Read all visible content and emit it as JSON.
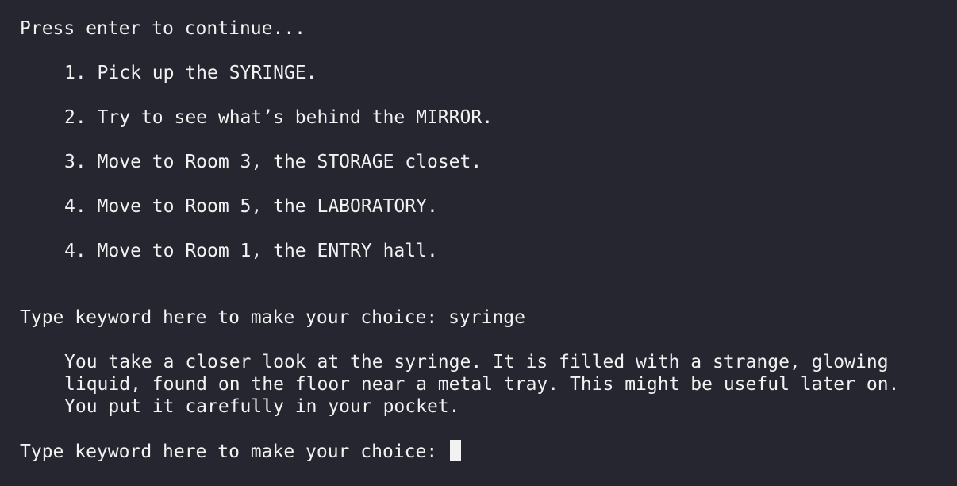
{
  "terminal": {
    "continue_prompt": "Press enter to continue...",
    "options": [
      "1. Pick up the SYRINGE.",
      "2. Try to see what’s behind the MIRROR.",
      "3. Move to Room 3, the STORAGE closet.",
      "4. Move to Room 5, the LABORATORY.",
      "4. Move to Room 1, the ENTRY hall."
    ],
    "choice_prompt": "Type keyword here to make your choice:",
    "first_input": "syringe",
    "response_lines": [
      "You take a closer look at the syringe. It is filled with a strange, glowing",
      "liquid, found on the floor near a metal tray. This might be useful later on.",
      "You put it carefully in your pocket."
    ],
    "second_prompt": "Type keyword here to make your choice:",
    "second_input": ""
  },
  "colors": {
    "background": "#262630",
    "text": "#f2f2f2",
    "cursor": "#f2f2f2"
  }
}
